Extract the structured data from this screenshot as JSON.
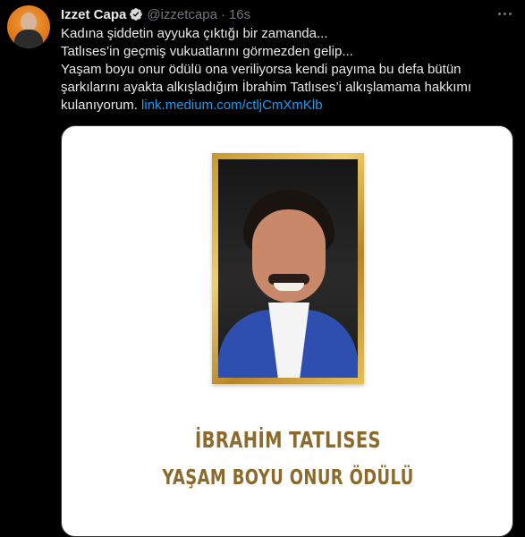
{
  "tweet": {
    "author_name": "Izzet Capa",
    "author_handle": "@izzetcapa",
    "separator": "·",
    "timestamp": "16s",
    "verified": true,
    "text_lines": [
      "Kadına şiddetin ayyuka çıktığı bir zamanda...",
      "Tatlıses’in geçmiş vukuatlarını görmezden gelip...",
      "Yaşam boyu onur ödülü ona veriliyorsa kendi payıma bu defa bütün",
      "şarkılarını ayakta alkışladığım İbrahim Tatlıses’i alkışlamama hakkımı"
    ],
    "last_line_text": "kulanıyorum.",
    "link_text": "link.medium.com/ctljCmXmKlb"
  },
  "media": {
    "award_name": "İBRAHİM TATLISES",
    "award_title": "YAŞAM BOYU ONUR ÖDÜLÜ"
  },
  "colors": {
    "background": "#000000",
    "text": "#e7e9ea",
    "muted": "#71767b",
    "link": "#1d9bf0",
    "verified_badge": "#d9d9d9",
    "gold": "#8b6a2b",
    "avatar_bg": "#e0791c"
  },
  "icons": {
    "verified": "verified-badge-icon",
    "more": "more-options-icon"
  }
}
